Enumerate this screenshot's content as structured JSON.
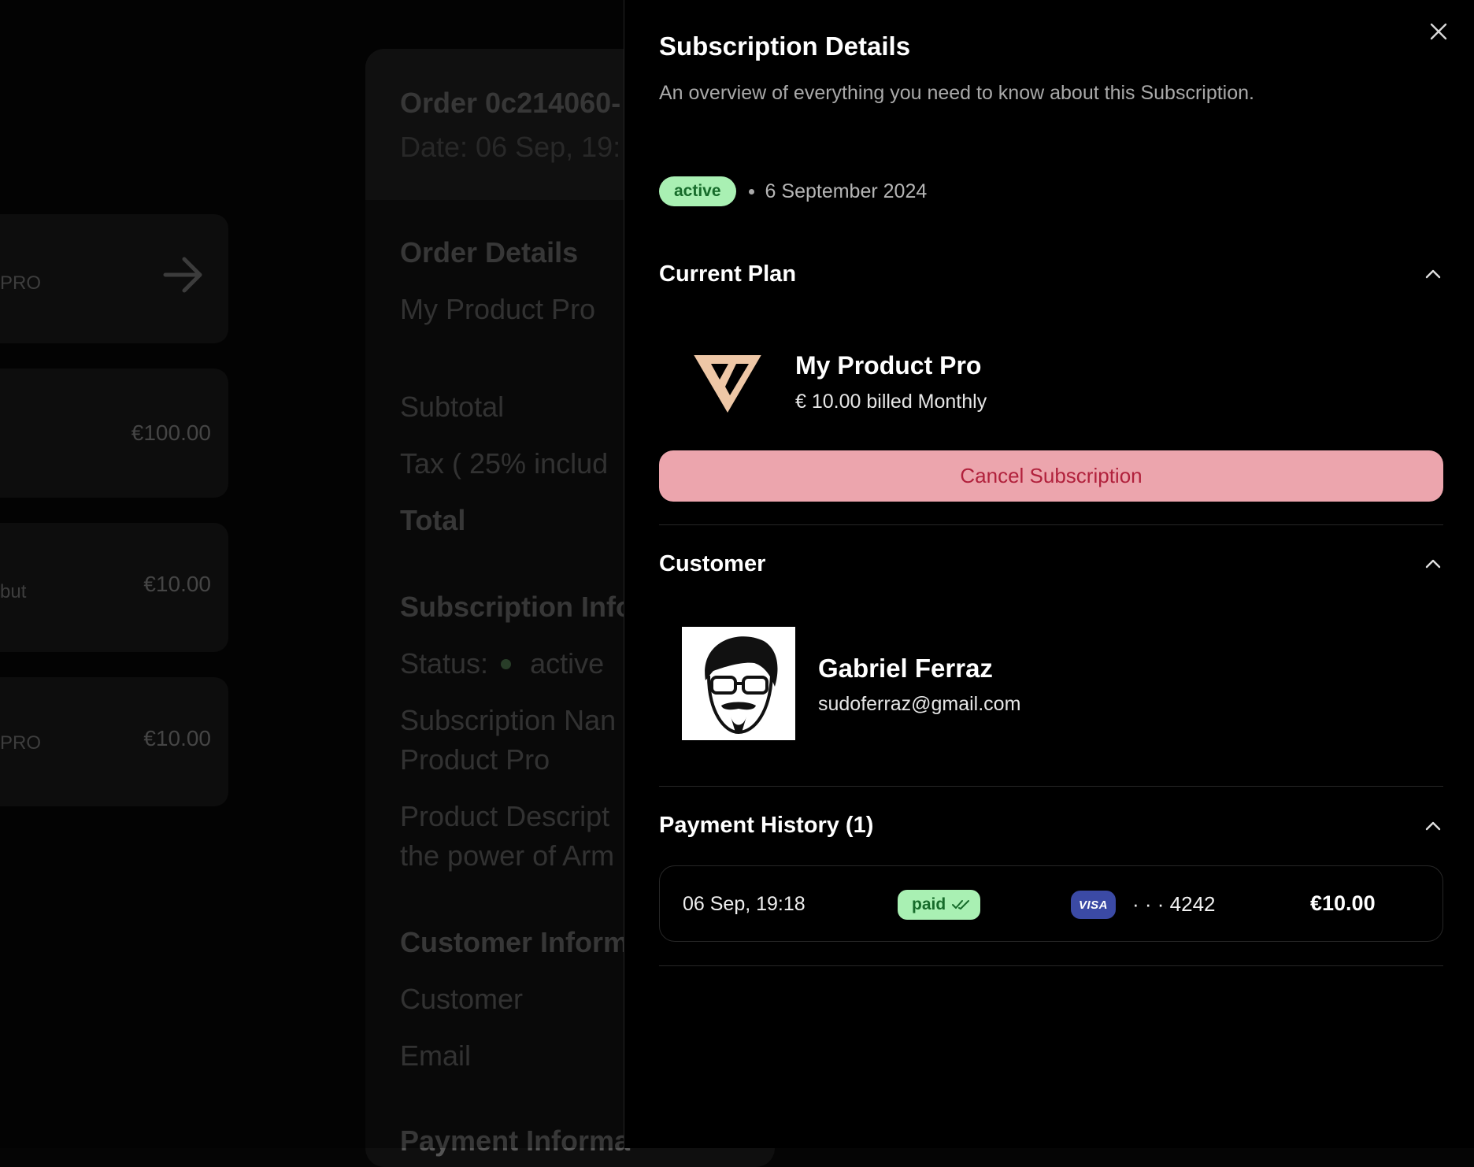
{
  "background": {
    "cards": [
      {
        "label": "PRO",
        "value": ""
      },
      {
        "label": "",
        "value": "€100.00"
      },
      {
        "label": "but",
        "value": "€10.00"
      },
      {
        "label": "PRO",
        "value": "€10.00"
      }
    ],
    "order": {
      "title": "Order 0c214060-",
      "date": "Date: 06 Sep, 19:",
      "details_heading": "Order Details",
      "product": "My Product Pro",
      "subtotal": "Subtotal",
      "tax": "Tax ( 25% includ",
      "total": "Total",
      "subscription_heading": "Subscription Info",
      "status_label": "Status:",
      "status_value": "active",
      "subscription_name_1": "Subscription Nan",
      "subscription_name_2": "Product Pro",
      "product_desc_1": "Product Descript",
      "product_desc_2": "the power of Arm",
      "customer_heading": "Customer Inform",
      "customer_label": "Customer",
      "email_label": "Email",
      "payment_heading": "Payment Informa"
    }
  },
  "drawer": {
    "title": "Subscription Details",
    "description": "An overview of everything you need to know about this Subscription.",
    "status": "active",
    "date": "6 September 2024",
    "current_plan": {
      "heading": "Current Plan",
      "name": "My Product Pro",
      "price": "€ 10.00 billed Monthly",
      "cancel_label": "Cancel Subscription"
    },
    "customer": {
      "heading": "Customer",
      "name": "Gabriel Ferraz",
      "email": "sudoferraz@gmail.com"
    },
    "payment_history": {
      "heading": "Payment History (1)",
      "items": [
        {
          "date": "06 Sep, 19:18",
          "status": "paid",
          "brand": "VISA",
          "card": "· · · 4242",
          "amount": "€10.00"
        }
      ]
    }
  },
  "colors": {
    "accent_green_bg": "#a9f0b3",
    "accent_green_text": "#166b2a",
    "cancel_bg": "#eca5ad",
    "cancel_text": "#b1213c",
    "visa_bg": "#3b4aa5"
  },
  "icons": [
    "close-icon",
    "chevron-up-icon",
    "arrow-right-icon",
    "product-logo-icon",
    "double-check-icon",
    "visa-card-icon"
  ]
}
